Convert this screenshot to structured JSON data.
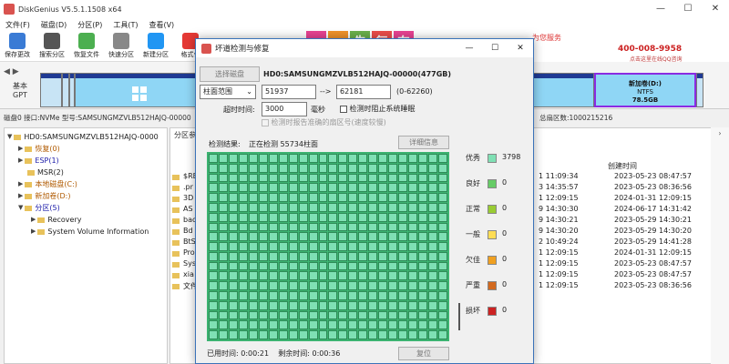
{
  "app": {
    "title": "DiskGenius V5.5.1.1508 x64",
    "min": "—",
    "max": "☐",
    "close": "✕"
  },
  "menu": [
    "文件(F)",
    "磁盘(D)",
    "分区(P)",
    "工具(T)",
    "查看(V)"
  ],
  "toolbar": [
    {
      "label": "保存更改",
      "color": "#3a7bd5"
    },
    {
      "label": "搜索分区",
      "color": "#555555"
    },
    {
      "label": "恢复文件",
      "color": "#4caf50"
    },
    {
      "label": "快速分区",
      "color": "#888888"
    },
    {
      "label": "新建分区",
      "color": "#2196f3"
    },
    {
      "label": "格式化",
      "color": "#e53935"
    }
  ],
  "banner": {
    "tiles": [
      "先",
      "复",
      "东"
    ],
    "tile_colors": [
      "#e84393",
      "#f0932b",
      "#6ab04c",
      "#eb4d4b",
      "#e84393"
    ],
    "service": "为您服务",
    "phone": "400-008-9958",
    "online": "点击这里在线QQ咨询"
  },
  "diskbar": {
    "nav": "◀ ▶",
    "basic": "基本",
    "gpt": "GPT",
    "newvol_name": "新加卷(D:)",
    "newvol_fs": "NTFS",
    "newvol_size": "78.5GB"
  },
  "diskinfo": {
    "left": "磁盘0 接口:NVMe  型号:SAMSUNGMZVLB512HAJQ-00000",
    "right": "总扇区数:1000215216"
  },
  "tree": [
    {
      "label": "HD0:SAMSUNGMZVLB512HAJQ-0000",
      "cls": "",
      "indent": 0,
      "arrow": "▼"
    },
    {
      "label": "恢复(0)",
      "cls": "orange",
      "indent": 12,
      "arrow": "▶"
    },
    {
      "label": "ESP(1)",
      "cls": "hl",
      "indent": 12,
      "arrow": "▶"
    },
    {
      "label": "MSR(2)",
      "cls": "",
      "indent": 12,
      "arrow": ""
    },
    {
      "label": "本地磁盘(C:)",
      "cls": "orange",
      "indent": 12,
      "arrow": "▶"
    },
    {
      "label": "新加卷(D:)",
      "cls": "orange",
      "indent": 12,
      "arrow": "▶"
    },
    {
      "label": "分区(5)",
      "cls": "hl",
      "indent": 12,
      "arrow": "▼"
    },
    {
      "label": "Recovery",
      "cls": "",
      "indent": 26,
      "arrow": "▶"
    },
    {
      "label": "System Volume Information",
      "cls": "",
      "indent": 26,
      "arrow": "▶"
    }
  ],
  "files": {
    "tab": "分区参数",
    "created_header": "创建时间",
    "names": [
      "$RE",
      ".pr",
      "3D",
      "AS",
      "bac",
      "Bd",
      "BtS",
      "Pro",
      "Sys",
      "xia",
      "文件"
    ],
    "modified": [
      "1 11:09:34",
      "3 14:35:57",
      "1 12:09:15",
      "9 14:30:30",
      "9 14:30:21",
      "9 14:30:20",
      "2 10:49:24",
      "1 12:09:15",
      "1 12:09:15",
      "1 12:09:15",
      "1 12:09:15"
    ],
    "created": [
      "2023-05-23 08:47:57",
      "2023-05-23 08:36:56",
      "2024-01-31 12:09:15",
      "2024-06-17 14:31:42",
      "2023-05-29 14:30:21",
      "2023-05-29 14:30:20",
      "2023-05-29 14:41:28",
      "2024-01-31 12:09:15",
      "2023-05-23 08:47:57",
      "2023-05-23 08:47:57",
      "2023-05-23 08:36:56"
    ]
  },
  "dialog": {
    "title": "坏道检测与修复",
    "select_disk": "选择磁盘",
    "disk": "HD0:SAMSUNGMZVLB512HAJQ-00000(477GB)",
    "range_mode": "柱面范围",
    "cyl_from": "51937",
    "arrow": "-->",
    "cyl_to": "62181",
    "cyl_range": "(0-62260)",
    "timeout_label": "超时时间:",
    "timeout": "3000",
    "timeout_unit": "毫秒",
    "opt_prevent_sleep": "检测时阻止系统睡眠",
    "opt_report": "检测时报告准确的扇区号(速度较慢)",
    "result_label": "检测结果:",
    "status": "正在检测 55734柱面",
    "detail_btn": "详细信息",
    "elapsed_label": "已用时间:",
    "elapsed": "0:00:21",
    "remaining_label": "剩余时间:",
    "remaining": "0:00:36",
    "reset_btn": "复位"
  },
  "legend": [
    {
      "name": "优秀",
      "color": "#7fe0b4",
      "value": "3798"
    },
    {
      "name": "良好",
      "color": "#66cc66",
      "value": "0"
    },
    {
      "name": "正常",
      "color": "#99cc33",
      "value": "0"
    },
    {
      "name": "一般",
      "color": "#ffdd55",
      "value": "0"
    },
    {
      "name": "欠佳",
      "color": "#f0a020",
      "value": "0"
    },
    {
      "name": "严重",
      "color": "#d2691e",
      "value": "0"
    },
    {
      "name": "损坏",
      "color": "#cc2222",
      "value": "0"
    }
  ]
}
